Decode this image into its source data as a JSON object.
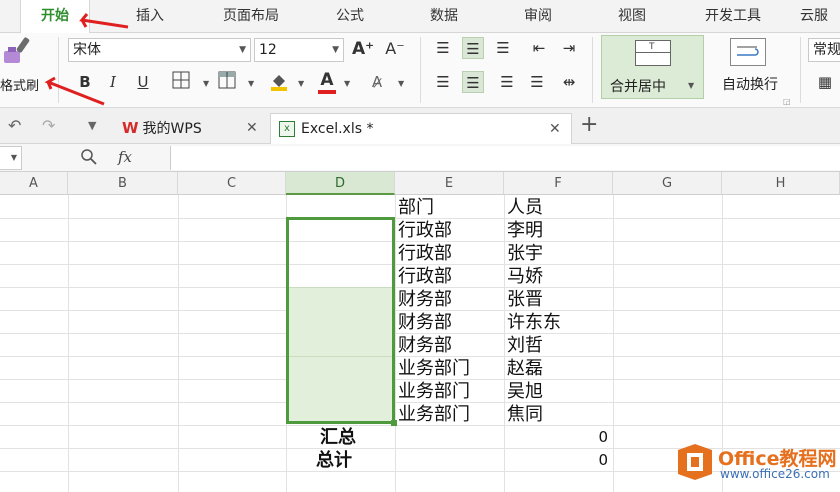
{
  "menu": {
    "tabs": [
      "开始",
      "插入",
      "页面布局",
      "公式",
      "数据",
      "审阅",
      "视图",
      "开发工具",
      "云服"
    ],
    "active": "开始"
  },
  "ribbon": {
    "format_painter_label": "格式刷",
    "font_name": "宋体",
    "font_size": "12",
    "increase_font": "A⁺",
    "decrease_font": "A⁻",
    "bold": "B",
    "italic": "I",
    "underline": "U",
    "merge_label": "合并居中",
    "wrap_label": "自动换行",
    "general_label": "常规",
    "accent_color": "#2f8f2f"
  },
  "documents": {
    "home_tab": "我的WPS",
    "active_tab": "Excel.xls *",
    "new_tab": "+"
  },
  "formula_bar": {
    "fx": "fx",
    "value": ""
  },
  "sheet": {
    "columns": [
      "A",
      "B",
      "C",
      "D",
      "E",
      "F",
      "G",
      "H"
    ],
    "selected_column": "D",
    "header_row": {
      "e": "部门",
      "f": "人员"
    },
    "rows": [
      {
        "e": "行政部",
        "f": "李明"
      },
      {
        "e": "行政部",
        "f": "张宇"
      },
      {
        "e": "行政部",
        "f": "马娇"
      },
      {
        "e": "财务部",
        "f": "张晋"
      },
      {
        "e": "财务部",
        "f": "许东东"
      },
      {
        "e": "财务部",
        "f": "刘哲"
      },
      {
        "e": "业务部门",
        "f": "赵磊"
      },
      {
        "e": "业务部门",
        "f": "吴旭"
      },
      {
        "e": "业务部门",
        "f": "焦同"
      }
    ],
    "summary_label": "汇总",
    "summary_value": "0",
    "total_label": "总计",
    "total_value": "0"
  },
  "watermark": {
    "brand": "Office教程网",
    "url": "www.office26.com"
  }
}
